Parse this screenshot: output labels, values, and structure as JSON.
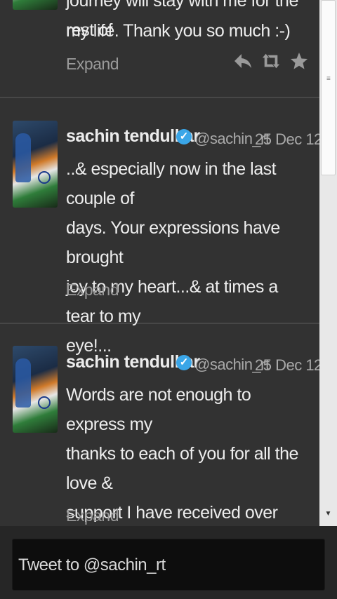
{
  "tweets": [
    {
      "text_lines": [
        "journey will stay with me for the rest of",
        "my life. Thank you so much :-)"
      ],
      "expand_label": "Expand"
    },
    {
      "name": "sachin tendulkar",
      "handle": "@sachin_rt",
      "date": "25 Dec 12",
      "text": "..& especially now in the last couple of\ndays. Your expressions have brought\njoy to my heart...& at times a tear to my\neye!...",
      "expand_label": "Expand"
    },
    {
      "name": "sachin tendulkar",
      "handle": "@sachin_rt",
      "date": "25 Dec 12",
      "text": "Words are not enough to express my\nthanks to each of you for all the love &\nsupport I have received over the\nyears.....",
      "expand_label": "Expand"
    }
  ],
  "actions": [
    "reply-icon",
    "retweet-icon",
    "favorite-icon"
  ],
  "compose": {
    "placeholder": "Tweet to @sachin_rt"
  },
  "colors": {
    "background": "#323232",
    "verified": "#3aa6e8",
    "compose_bg": "#0d0d0d"
  }
}
